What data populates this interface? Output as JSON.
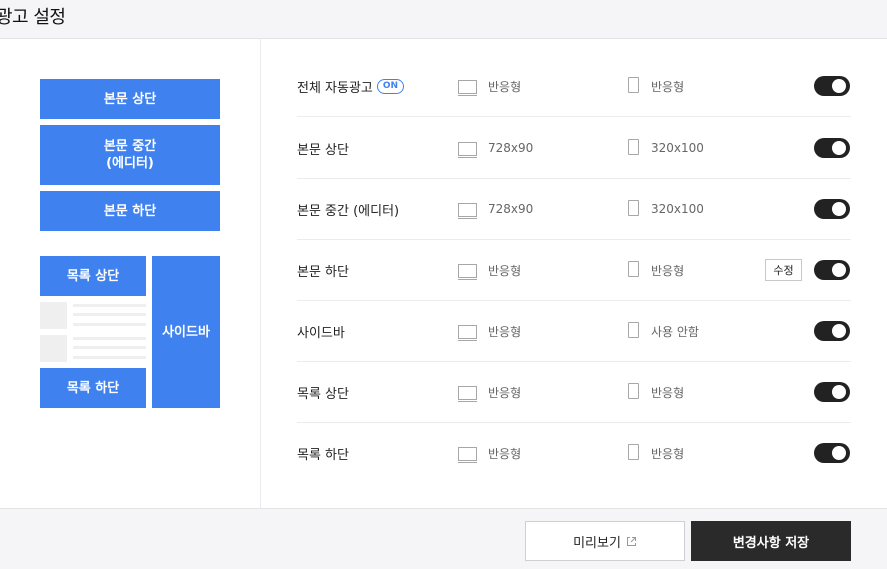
{
  "header": {
    "title": "광고 설정"
  },
  "diagram": {
    "body_top": "본문 상단",
    "body_middle_line1": "본문 중간",
    "body_middle_line2": "(에디터)",
    "body_bottom": "본문 하단",
    "list_top": "목록 상단",
    "list_bottom": "목록 하단",
    "sidebar": "사이드바"
  },
  "rows": [
    {
      "label": "전체 자동광고",
      "badge": "ON",
      "pc": "반응형",
      "mobile": "반응형",
      "enabled": true
    },
    {
      "label": "본문 상단",
      "pc": "728x90",
      "mobile": "320x100",
      "enabled": true
    },
    {
      "label": "본문 중간 (에디터)",
      "pc": "728x90",
      "mobile": "320x100",
      "enabled": true
    },
    {
      "label": "본문 하단",
      "pc": "반응형",
      "mobile": "반응형",
      "edit": "수정",
      "enabled": true
    },
    {
      "label": "사이드바",
      "pc": "반응형",
      "mobile": "사용 안함",
      "enabled": true
    },
    {
      "label": "목록 상단",
      "pc": "반응형",
      "mobile": "반응형",
      "enabled": true
    },
    {
      "label": "목록 하단",
      "pc": "반응형",
      "mobile": "반응형",
      "enabled": true
    }
  ],
  "footer": {
    "preview": "미리보기",
    "save": "변경사항 저장"
  }
}
